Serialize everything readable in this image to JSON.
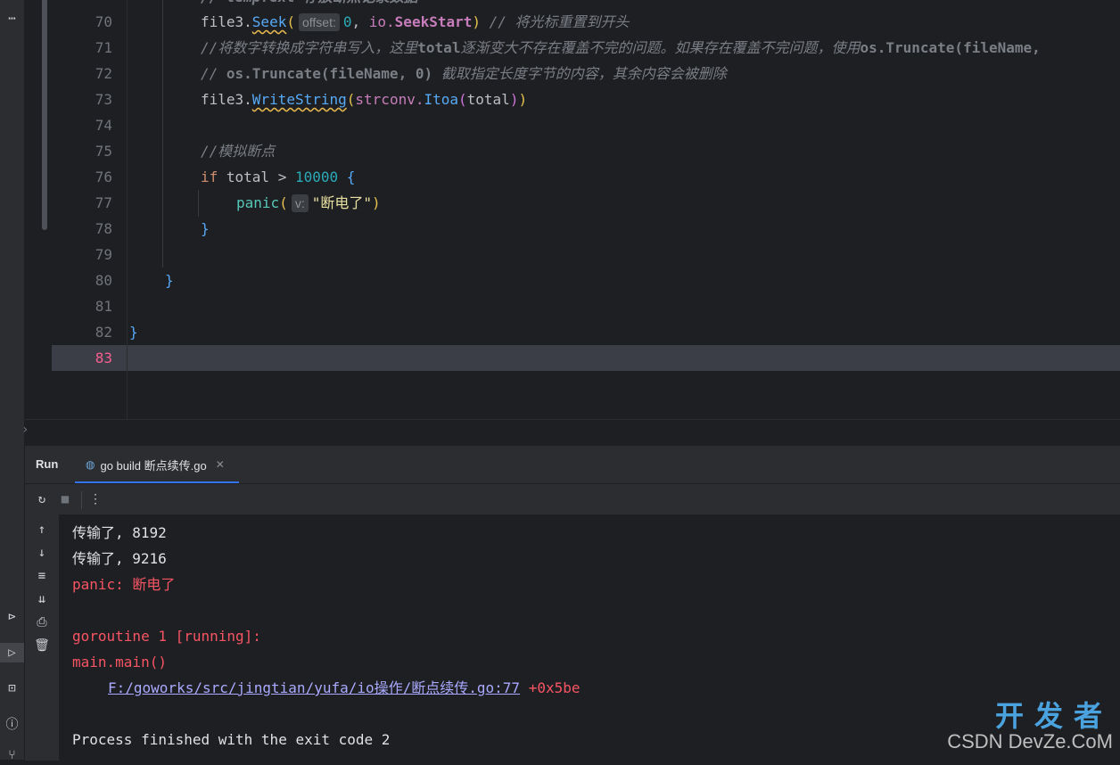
{
  "editor": {
    "lines": [
      {
        "num": "70"
      },
      {
        "num": "71"
      },
      {
        "num": "72"
      },
      {
        "num": "73"
      },
      {
        "num": "74"
      },
      {
        "num": "75"
      },
      {
        "num": "76"
      },
      {
        "num": "77"
      },
      {
        "num": "78"
      },
      {
        "num": "79"
      },
      {
        "num": "80"
      },
      {
        "num": "81"
      },
      {
        "num": "82"
      },
      {
        "num": "83"
      }
    ],
    "l70": {
      "obj": "file3.",
      "fn": "Seek",
      "hint": "offset:",
      "arg1": "0",
      "sep": ", ",
      "pkg": "io.",
      "const": "SeekStart",
      "cmt": "// 将光标重置到开头"
    },
    "l71": {
      "cmt1": "//将数字转换成字符串写入，这里",
      "b1": "total",
      "cmt2": "逐渐变大不存在覆盖不完的问题。如果存在覆盖不完问题，使用",
      "b2": "os.Truncate(fileName,"
    },
    "l72": {
      "cmt1": "// ",
      "b1": "os.Truncate(fileName, 0)",
      "cmt2": " 截取指定长度字节的内容，其余内容会被删除"
    },
    "l73": {
      "obj": "file3.",
      "fn": "WriteString",
      "pkg": "strconv.",
      "fn2": "Itoa",
      "arg": "total"
    },
    "l75": {
      "cmt": "//模拟断点"
    },
    "l76": {
      "kw": "if",
      "var": " total > ",
      "num": "10000",
      "brace": " {"
    },
    "l77": {
      "fn": "panic",
      "hint": "v:",
      "str": "\"断电了\""
    },
    "l78": {
      "brace": "}"
    },
    "l80": {
      "brace": "}"
    },
    "l82": {
      "brace": "}"
    }
  },
  "run_panel": {
    "label": "Run",
    "tab_label": "go build 断点续传.go",
    "console": {
      "line1": "传输了, 8192",
      "line2": "传输了, 9216",
      "line3": "panic: 断电了",
      "line4": "goroutine 1 [running]:",
      "line5": "main.main()",
      "link": "F:/goworks/src/jingtian/yufa/io操作/断点续传.go:77",
      "offset": " +0x5be",
      "line7": "Process finished with the exit code 2"
    }
  },
  "watermark": {
    "big": "开发者",
    "site": "CSDN DevZe.CoM"
  }
}
